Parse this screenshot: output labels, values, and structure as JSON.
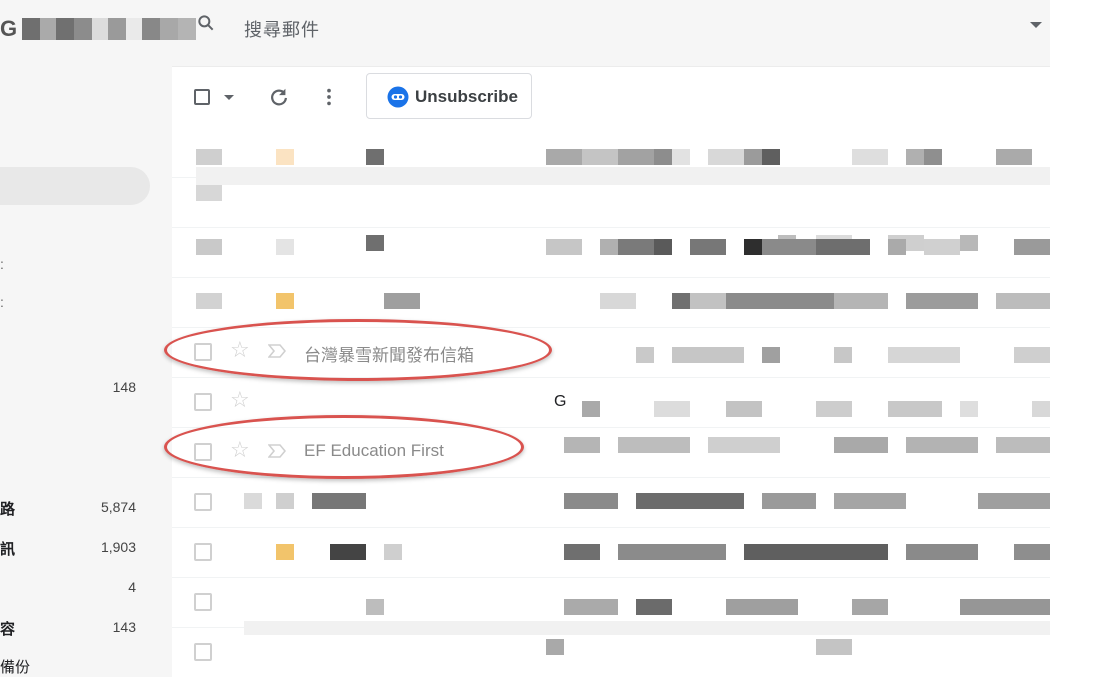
{
  "header": {
    "logo_text": "G",
    "search_text": "搜尋郵件"
  },
  "toolbar": {
    "unsubscribe_label": "Unsubscribe"
  },
  "sidebar": {
    "items": [
      {
        "label": "",
        "count": "148"
      },
      {
        "label": "路",
        "count": "5,874"
      },
      {
        "label": "訊",
        "count": "1,903"
      },
      {
        "label": "",
        "count": "4"
      },
      {
        "label": "容",
        "count": "143"
      },
      {
        "label": "備份",
        "count": ""
      }
    ]
  },
  "emails": [
    {
      "sender": "台灣暴雪新聞發布信箱",
      "annotated": true
    },
    {
      "sender": "",
      "subject_initial": "G",
      "annotated": false
    },
    {
      "sender": "EF Education First",
      "annotated": true
    }
  ],
  "colors": {
    "annotation": "#d9534f",
    "unsubscribe_icon": "#1a73e8",
    "label_orange": "#f2c46b"
  },
  "icons": {
    "checkbox": "checkbox-icon",
    "star": "star-icon",
    "importance": "importance-marker-icon",
    "refresh": "refresh-icon",
    "more": "more-vert-icon"
  }
}
